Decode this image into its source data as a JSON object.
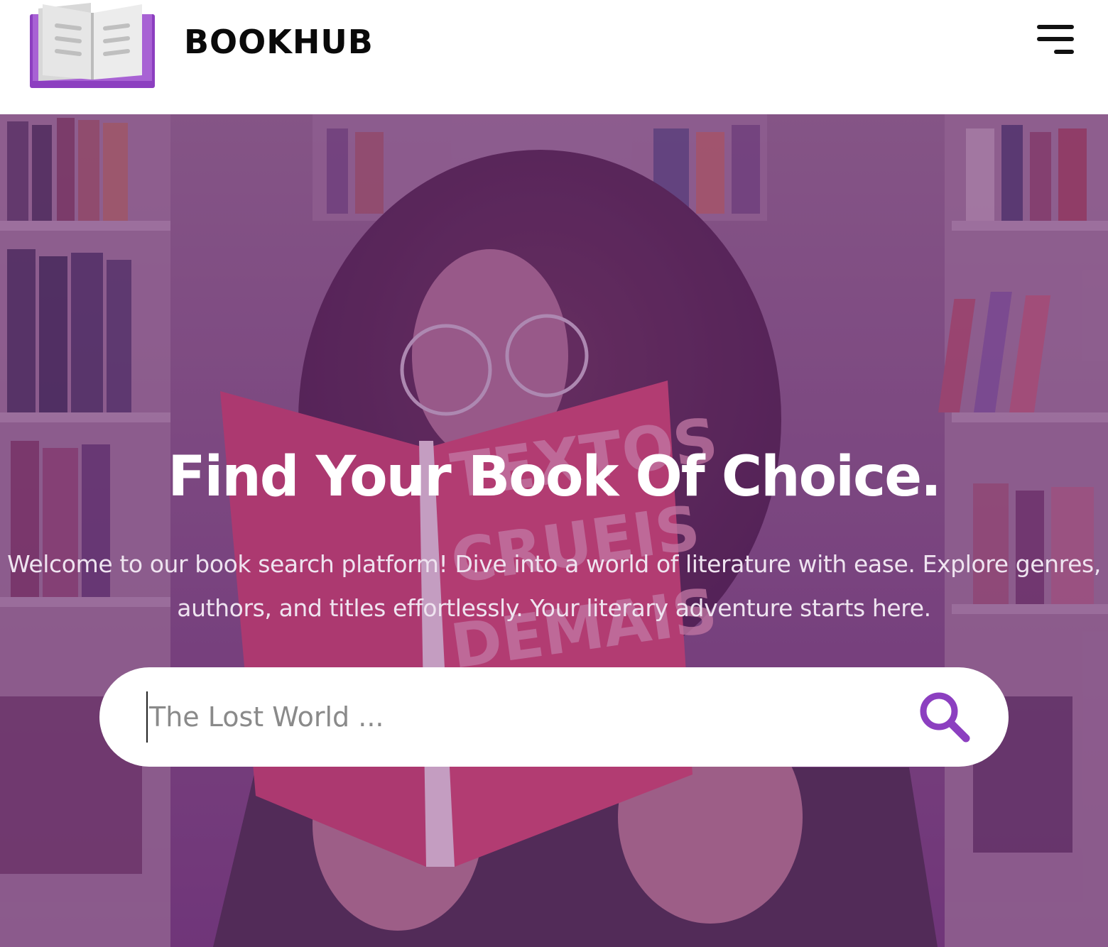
{
  "header": {
    "brand": "BOOKHUB",
    "logo_icon": "open-book-icon",
    "menu_icon": "hamburger-menu-icon"
  },
  "hero": {
    "title": "Find Your Book Of Choice.",
    "description": "Welcome to our book search platform! Dive into a world of literature with ease. Explore genres, authors, and titles effortlessly. Your literary adventure starts here.",
    "background": "photo of a woman with glasses reading a red book in a library",
    "overlay_color": "#7a2f86",
    "book_cover_text": "TEXTOS CRUEIS DEMAIS"
  },
  "search": {
    "placeholder": "The Lost World ...",
    "value": "",
    "button_icon": "search-icon"
  },
  "colors": {
    "accent": "#8c3fc0",
    "text_dark": "#0a0a0a",
    "hero_text": "#ffffff"
  }
}
